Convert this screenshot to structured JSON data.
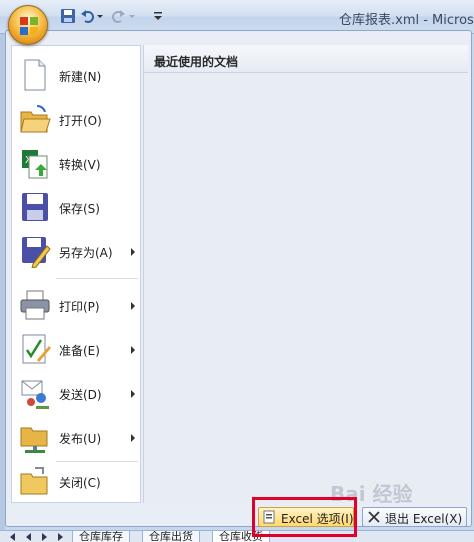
{
  "app": {
    "title": "仓库报表.xml - Micros"
  },
  "quick_access": {
    "icons": [
      "save-icon",
      "undo-icon",
      "redo-icon",
      "customize-icon"
    ]
  },
  "menu": {
    "recent_title": "最近使用的文档",
    "commands": [
      {
        "label": "新建(N)",
        "icon": "new-document-icon",
        "has_submenu": false
      },
      {
        "label": "打开(O)",
        "icon": "open-folder-icon",
        "has_submenu": false
      },
      {
        "label": "转换(V)",
        "icon": "convert-icon",
        "has_submenu": false
      },
      {
        "label": "保存(S)",
        "icon": "save-disk-icon",
        "has_submenu": false
      },
      {
        "label": "另存为(A)",
        "icon": "save-as-icon",
        "has_submenu": true
      },
      {
        "label": "打印(P)",
        "icon": "printer-icon",
        "has_submenu": true
      },
      {
        "label": "准备(E)",
        "icon": "prepare-icon",
        "has_submenu": true
      },
      {
        "label": "发送(D)",
        "icon": "send-icon",
        "has_submenu": true
      },
      {
        "label": "发布(U)",
        "icon": "publish-icon",
        "has_submenu": true
      },
      {
        "label": "关闭(C)",
        "icon": "close-folder-icon",
        "has_submenu": false
      }
    ],
    "footer": {
      "options_label": "Excel 选项(I)",
      "exit_label": "退出 Excel(X)"
    }
  },
  "sheets": {
    "tabs": [
      "仓库库存",
      "仓库出货",
      "仓库收货"
    ]
  },
  "watermark": "Bai 经验",
  "colors": {
    "accent": "#e2002a",
    "ribbon_blue": "#c3d5ec",
    "orb_orange": "#e08a10"
  }
}
